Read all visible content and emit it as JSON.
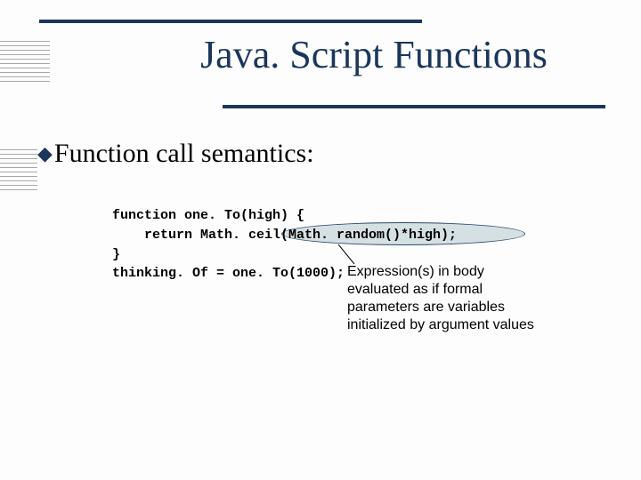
{
  "title": "Java. Script Functions",
  "bullet": {
    "text": "Function call semantics:"
  },
  "code": {
    "line1": "function one. To(high) {",
    "line2": "    return Math. ceil(Math. random()*high);",
    "line3": "}",
    "line4": "thinking. Of = one. To(1000);"
  },
  "callout": {
    "text": "Expression(s) in body evaluated as if formal parameters are variables initialized by argument values"
  }
}
